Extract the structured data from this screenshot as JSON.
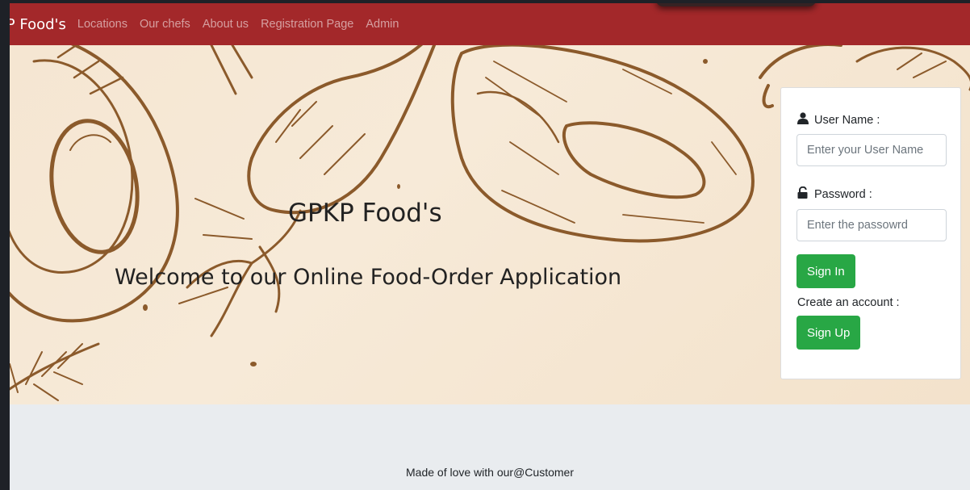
{
  "navbar": {
    "brand": "KP Food's",
    "links": [
      "Locations",
      "Our chefs",
      "About us",
      "Registration Page",
      "Admin"
    ]
  },
  "hero": {
    "title": "GPKP Food's",
    "subtitle": "Welcome to our Online Food-Order Application"
  },
  "login": {
    "username_label": "User Name :",
    "username_placeholder": "Enter your User Name",
    "password_label": "Password :",
    "password_placeholder": "Enter the passowrd",
    "signin_label": "Sign In",
    "create_account_text": "Create an account :",
    "signup_label": "Sign Up"
  },
  "footer": {
    "text": "Made of love with our@Customer"
  },
  "colors": {
    "navbar_bg": "#a3282a",
    "button_green": "#28a745",
    "illustration_brown": "#8b5a2b",
    "hero_bg": "#f5e6d2"
  },
  "icons": {
    "username": "user-icon",
    "password": "unlock-icon"
  }
}
